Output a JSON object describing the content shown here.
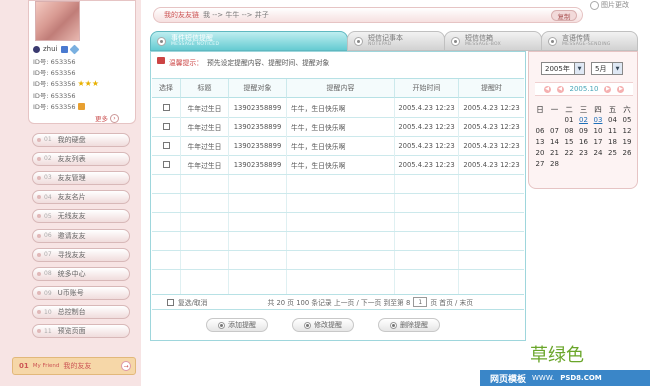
{
  "breadcrumb": {
    "label": "我的友友链",
    "path": "我 --> 牛牛 --> 井子"
  },
  "copy_label": "复制",
  "pic_toggle_label": "图片更改",
  "profile": {
    "username": "zhui",
    "ids": [
      "ID号: 653356",
      "ID号: 653356",
      "ID号: 653356",
      "ID号: 653356",
      "ID号: 653356"
    ],
    "more_label": "更多"
  },
  "menu": [
    {
      "num": "01",
      "label": "我的硬盘"
    },
    {
      "num": "02",
      "label": "友友列表"
    },
    {
      "num": "03",
      "label": "友友管理"
    },
    {
      "num": "04",
      "label": "友友名片"
    },
    {
      "num": "05",
      "label": "无线友友"
    },
    {
      "num": "06",
      "label": "邀请友友"
    },
    {
      "num": "07",
      "label": "寻找友友"
    },
    {
      "num": "08",
      "label": "统多中心"
    },
    {
      "num": "09",
      "label": "U币账号"
    },
    {
      "num": "10",
      "label": "总控制台"
    },
    {
      "num": "11",
      "label": "预览页面"
    }
  ],
  "left_footer": {
    "num": "01",
    "en": "My Friend",
    "label": "我的友友",
    "arrow": "→"
  },
  "tabs": [
    {
      "title": "事件短信提醒",
      "sub": "MESSAGE NOTICED"
    },
    {
      "title": "短信记事本",
      "sub": "NOTEPAD"
    },
    {
      "title": "短信信箱",
      "sub": "MESSAGE-BOX"
    },
    {
      "title": "言语传情",
      "sub": "MESSAGE-SENDING"
    }
  ],
  "tip": {
    "label": "温馨提示：",
    "text": "预先设定提醒内容、提醒时间、提醒对象"
  },
  "table": {
    "headers": [
      "选择",
      "标题",
      "提醒对象",
      "提醒内容",
      "开始时间",
      "提醒时"
    ],
    "rows": [
      [
        "牛年过生日",
        "13902358899",
        "牛牛，生日快乐啊",
        "2005.4.23 12:23",
        "2005.4.23 12:23"
      ],
      [
        "牛年过生日",
        "13902358899",
        "牛牛，生日快乐啊",
        "2005.4.23 12:23",
        "2005.4.23 12:23"
      ],
      [
        "牛年过生日",
        "13902358899",
        "牛牛，生日快乐啊",
        "2005.4.23 12:23",
        "2005.4.23 12:23"
      ],
      [
        "牛年过生日",
        "13902358899",
        "牛牛，生日快乐啊",
        "2005.4.23 12:23",
        "2005.4.23 12:23"
      ]
    ]
  },
  "pager": {
    "select_all": "复选/取消",
    "p1": "共 20 页 100 条记录 上一页 / 下一页 到至第 8",
    "page_value": "1",
    "p2": "页 首页 / 末页"
  },
  "actions": [
    "添加提醒",
    "修改提醒",
    "删除提醒"
  ],
  "calendar": {
    "year": "2005年",
    "month": "5月",
    "nav": "2005.10",
    "dow": [
      "日",
      "一",
      "二",
      "三",
      "四",
      "五",
      "六"
    ],
    "weeks": [
      [
        "",
        "",
        "01",
        "02",
        "03",
        "04",
        "05"
      ],
      [
        "06",
        "07",
        "08",
        "09",
        "10",
        "11",
        "12"
      ],
      [
        "13",
        "14",
        "15",
        "16",
        "17",
        "18",
        "19"
      ],
      [
        "20",
        "21",
        "22",
        "23",
        "24",
        "25",
        "26"
      ],
      [
        "27",
        "28",
        "",
        "",
        "",
        "",
        ""
      ]
    ],
    "link_days": [
      "02",
      "03"
    ]
  },
  "watermark": {
    "color_name": "草绿色",
    "site1": "网页模板",
    "site2": "WWW.",
    "site3": "PSD8.COM"
  }
}
